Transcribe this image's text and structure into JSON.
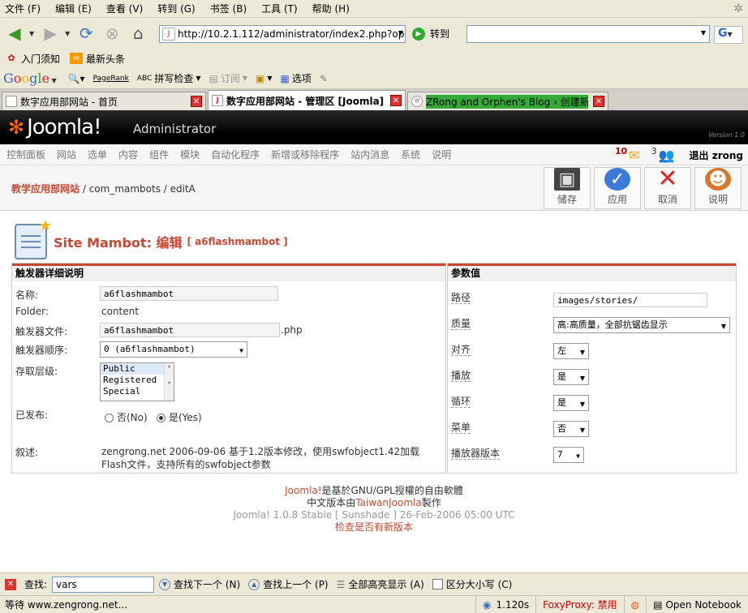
{
  "menubar": {
    "items": [
      "文件 (F)",
      "编辑 (E)",
      "查看 (V)",
      "转到 (G)",
      "书签 (B)",
      "工具 (T)",
      "帮助 (H)"
    ]
  },
  "navbar": {
    "url": "http://10.2.1.112/administrator/index2.php?op",
    "go_label": "转到"
  },
  "bookmarks": {
    "items": [
      "入门须知",
      "最新头条"
    ]
  },
  "google_toolbar": {
    "logo": "Google",
    "pagerank": "PageRank",
    "spellcheck": "拼写检查",
    "subscribe": "订阅",
    "options": "选项"
  },
  "tabs": [
    {
      "title": "数字应用部网站 - 首页",
      "active": false
    },
    {
      "title": "数字应用部网站 - 管理区 [Joomla]",
      "active": true
    },
    {
      "title": "ZRong and Orphen's Blog › 创建新...",
      "active": false
    }
  ],
  "joomla_header": {
    "logo": "Joomla!",
    "admin": "Administrator",
    "version": "Version 1.0"
  },
  "joomla_menu": {
    "items": [
      "控制面板",
      "网站",
      "选单",
      "内容",
      "组件",
      "模块",
      "自动化程序",
      "新增或移除程序",
      "站内消息",
      "系统",
      "说明"
    ],
    "messages_count": "10",
    "users_count": "3",
    "logout": "退出 zrong"
  },
  "path": {
    "site": "教学应用部网站",
    "rest": " / com_mambots / editA"
  },
  "toolbar": {
    "save": "储存",
    "apply": "应用",
    "cancel": "取消",
    "help": "说明"
  },
  "page": {
    "title": "Site Mambot: 编辑",
    "subtitle": "[ a6flashmambot ]"
  },
  "left_panel": {
    "heading": "触发器详细说明",
    "name_label": "名称:",
    "name_value": "a6flashmambot",
    "folder_label": "Folder:",
    "folder_value": "content",
    "file_label": "触发器文件:",
    "file_value": "a6flashmambot",
    "file_ext": ".php",
    "order_label": "触发器顺序:",
    "order_value": "0 (a6flashmambot)",
    "access_label": "存取层级:",
    "access_options": [
      "Public",
      "Registered",
      "Special"
    ],
    "published_label": "已发布:",
    "published_no": "否(No)",
    "published_yes": "是(Yes)",
    "desc_label": "叙述:",
    "desc_value": "zengrong.net 2006-09-06 基于1.2版本修改，使用swfobject1.42加载Flash文件，支持所有的swfobject参数"
  },
  "right_panel": {
    "heading": "参数值",
    "params": [
      {
        "label": "路径",
        "value": "images/stories/",
        "kind": "input"
      },
      {
        "label": "质量",
        "value": "高:高质量，全部抗锯齿显示",
        "kind": "select"
      },
      {
        "label": "对齐",
        "value": "左",
        "kind": "select"
      },
      {
        "label": "播放",
        "value": "是",
        "kind": "select"
      },
      {
        "label": "循环",
        "value": "是",
        "kind": "select"
      },
      {
        "label": "菜单",
        "value": "否",
        "kind": "select"
      },
      {
        "label": "播放器版本",
        "value": "7",
        "kind": "select"
      }
    ]
  },
  "footer": {
    "joomla_link": "Joomla!",
    "line1_rest": "是基於GNU/GPL授權的自由軟體",
    "line2_pre": "中文版本由",
    "line2_link": "TaiwanJoomla",
    "line2_post": "製作",
    "version": "Joomla! 1.0.8 Stable [ Sunshade ] 26-Feb-2006 05:00 UTC",
    "check": "检查是否有新版本"
  },
  "findbar": {
    "label": "查找:",
    "value": "vars",
    "next": "查找下一个 (N)",
    "prev": "查找上一个 (P)",
    "highlight": "全部高亮显示 (A)",
    "match_case": "区分大小写 (C)"
  },
  "statusbar": {
    "status": "等待 www.zengrong.net...",
    "time": "1.120s",
    "foxyproxy": "FoxyProxy: 禁用",
    "notebook": "Open Notebook"
  }
}
